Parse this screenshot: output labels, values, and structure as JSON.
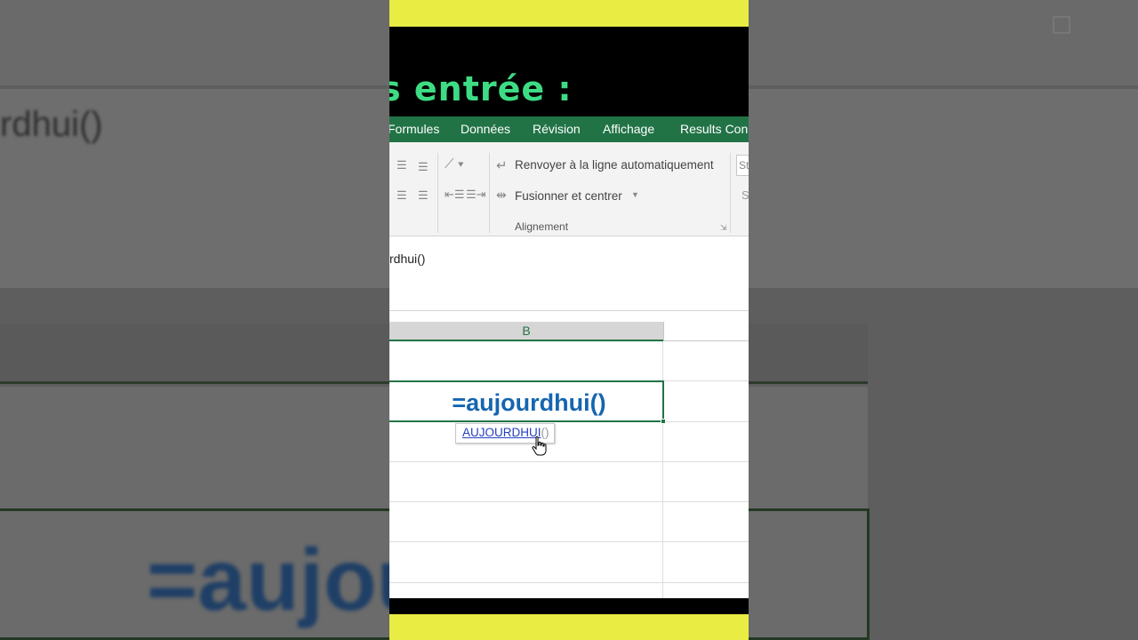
{
  "title": {
    "text": "is entrée :"
  },
  "ribbon": {
    "tabs": [
      "Formules",
      "Données",
      "Révision",
      "Affichage",
      "Results Conn"
    ],
    "wrap_text_label": "Renvoyer à la ligne automatiquement",
    "merge_label": "Fusionner et centrer",
    "group_label": "Alignement",
    "style_box_text": "St",
    "style_s_text": "S"
  },
  "formula_bar": {
    "text": "rdhui()"
  },
  "sheet": {
    "column_header": "B",
    "active_cell_formula": "=aujourdhui()",
    "autocomplete": {
      "function_name": "AUJOURDHUI",
      "paren": "()"
    }
  },
  "background": {
    "formula_text": "rdhui()",
    "big_formula_text": "=aujou"
  },
  "colors": {
    "excel_green": "#217346",
    "formula_blue": "#1565b0",
    "title_green": "#3ddc84",
    "banner_yellow": "#e8ec43"
  }
}
